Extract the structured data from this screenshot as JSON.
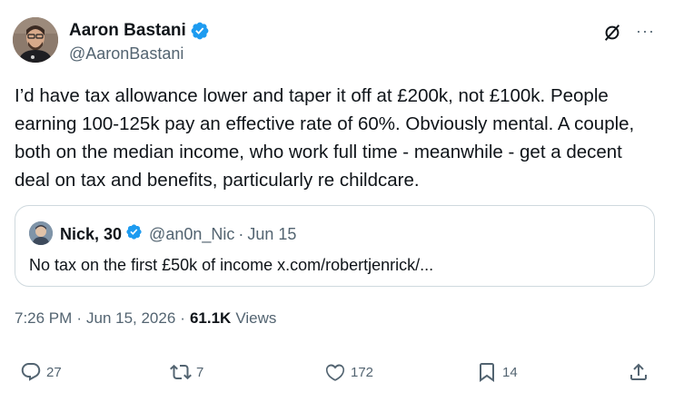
{
  "author": {
    "name": "Aaron Bastani",
    "handle": "@AaronBastani",
    "verified": true,
    "badge_color": "#1d9bf0"
  },
  "header_icons": [
    "grok-icon",
    "more-icon"
  ],
  "more_label": "···",
  "post": {
    "text": "I’d have tax allowance lower and taper it off at £200k, not £100k. People earning 100-125k pay an effective rate of 60%. Obviously mental.  A couple, both on the median income, who work full time - meanwhile - get a decent deal on tax and benefits, particularly re childcare."
  },
  "quote": {
    "name": "Nick, 30",
    "handle": "@an0n_Nic",
    "separator": "·",
    "date": "Jun 15",
    "text": "No tax on the first £50k of income x.com/robertjenrick/..."
  },
  "meta": {
    "time": "7:26 PM",
    "separator1": "·",
    "date": "Jun 15, 2026",
    "separator2": "·",
    "views_count": "61.1K",
    "views_label": "Views"
  },
  "actions": {
    "replies": "27",
    "reposts": "7",
    "likes": "172",
    "bookmarks": "14"
  },
  "colors": {
    "text": "#0f1419",
    "secondary": "#536471",
    "border": "#cfd9de",
    "accent": "#1d9bf0"
  }
}
